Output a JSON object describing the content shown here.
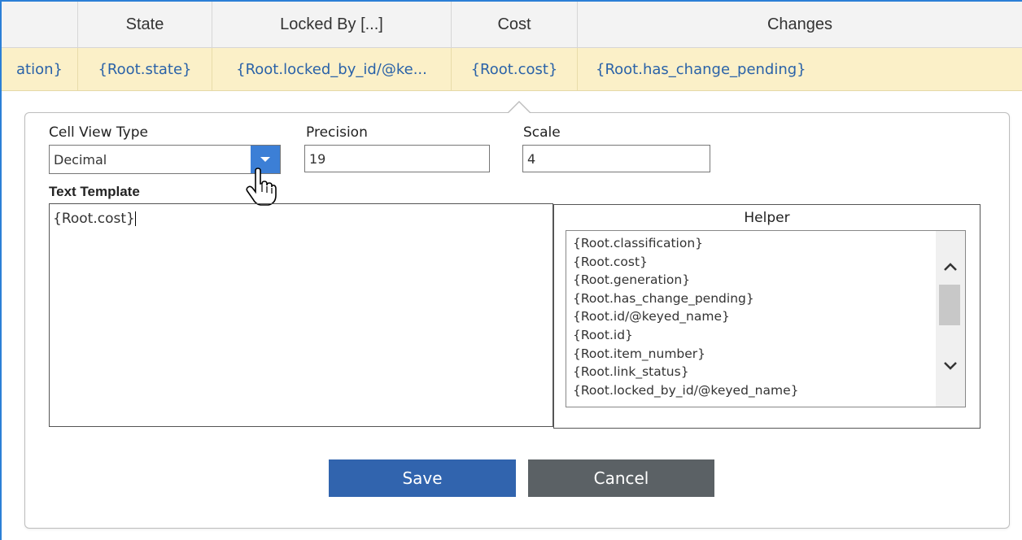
{
  "grid": {
    "headers": [
      "",
      "State",
      "Locked By [...]",
      "Cost",
      "Changes"
    ],
    "row": [
      "ation}",
      "{Root.state}",
      "{Root.locked_by_id/@ke...",
      "{Root.cost}",
      "{Root.has_change_pending}"
    ]
  },
  "editor": {
    "cell_view_type_label": "Cell View Type",
    "cell_view_type_value": "Decimal",
    "precision_label": "Precision",
    "precision_value": "19",
    "scale_label": "Scale",
    "scale_value": "4",
    "text_template_label": "Text Template",
    "text_template_value": "{Root.cost}",
    "helper_title": "Helper",
    "helper_items": [
      "{Root.classification}",
      "{Root.cost}",
      "{Root.generation}",
      "{Root.has_change_pending}",
      "{Root.id/@keyed_name}",
      "{Root.id}",
      "{Root.item_number}",
      "{Root.link_status}",
      "{Root.locked_by_id/@keyed_name}"
    ],
    "save_label": "Save",
    "cancel_label": "Cancel"
  },
  "colors": {
    "row_highlight": "#fbf0c8",
    "link_text": "#2a62a8",
    "save_button": "#3164ae",
    "cancel_button": "#5b6165",
    "dropdown_button": "#3c7fd6"
  },
  "icons": [
    "dropdown-arrow-icon",
    "hand-cursor-icon",
    "scroll-up-icon",
    "scroll-down-icon"
  ]
}
